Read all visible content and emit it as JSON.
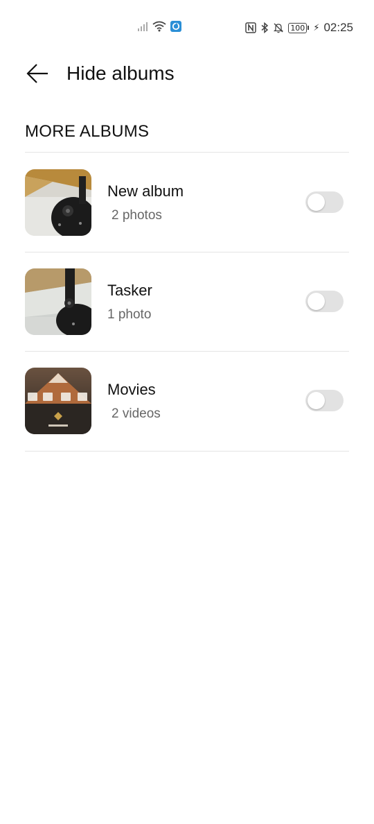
{
  "status_bar": {
    "time": "02:25",
    "battery": "100",
    "icons": [
      "signal-icon",
      "wifi-icon",
      "app-notification-icon",
      "nfc-icon",
      "bluetooth-icon",
      "mute-bell-icon",
      "battery-icon",
      "charging-icon"
    ]
  },
  "header": {
    "title": "Hide albums",
    "back_icon": "back-arrow-icon"
  },
  "section": {
    "title": "MORE ALBUMS"
  },
  "albums": [
    {
      "name": "New album",
      "count": "2 photos",
      "hidden": false
    },
    {
      "name": "Tasker",
      "count": "1 photo",
      "hidden": false
    },
    {
      "name": "Movies",
      "count": "2 videos",
      "hidden": false
    }
  ],
  "colors": {
    "toggle_off_track": "#e2e2e2",
    "divider": "#e4e4e4",
    "secondary_text": "#666666"
  }
}
